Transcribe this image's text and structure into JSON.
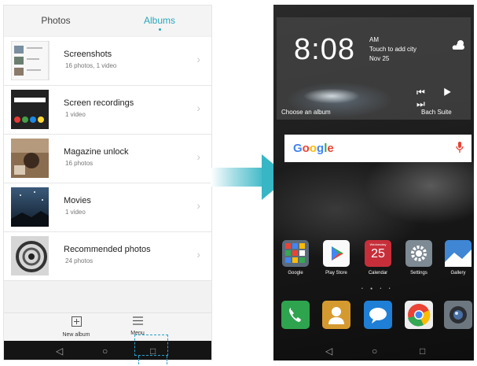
{
  "left_phone": {
    "tabs": [
      {
        "label": "Photos",
        "active": false
      },
      {
        "label": "Albums",
        "active": true
      }
    ],
    "accent_color": "#27a8ba",
    "albums": [
      {
        "title": "Screenshots",
        "subtitle": "16 photos, 1 video"
      },
      {
        "title": "Screen recordings",
        "subtitle": "1 video"
      },
      {
        "title": "Magazine unlock",
        "subtitle": "16 photos"
      },
      {
        "title": "Movies",
        "subtitle": "1 video"
      },
      {
        "title": "Recommended photos",
        "subtitle": "24 photos"
      }
    ],
    "chevron": "›",
    "bottom_bar": {
      "new_album_label": "New album",
      "new_album_icon": "add-square-icon",
      "menu_label": "Menu",
      "menu_icon": "menu-icon"
    },
    "nav": {
      "back": "◁",
      "home": "○",
      "recents": "□"
    }
  },
  "right_phone": {
    "clock": {
      "time": "8:08",
      "ampm": "AM",
      "city": "Touch to add city",
      "date": "Nov 25",
      "weather_icon": "partly-cloudy-icon"
    },
    "music": {
      "choose_album": "Choose an album",
      "artist": "Bach Suite",
      "controls": "⏮ ▶ ⏭"
    },
    "search": {
      "logo": "Google",
      "mic_icon": "microphone-icon"
    },
    "apps": [
      {
        "label": "Google",
        "icon": "google-folder-icon"
      },
      {
        "label": "Play Store",
        "icon": "play-store-icon"
      },
      {
        "label": "Calendar",
        "icon": "calendar-icon",
        "month": "Wednesday",
        "day": "25"
      },
      {
        "label": "Settings",
        "icon": "settings-gear-icon"
      },
      {
        "label": "Gallery",
        "icon": "gallery-icon"
      }
    ],
    "page_dots": "• ● • •",
    "dock": [
      {
        "icon": "phone-icon"
      },
      {
        "icon": "contacts-icon"
      },
      {
        "icon": "messages-icon"
      },
      {
        "icon": "chrome-icon"
      },
      {
        "icon": "camera-icon"
      }
    ],
    "nav": {
      "back": "◁",
      "home": "○",
      "recents": "□"
    }
  },
  "arrow_color": "#37b6c5",
  "highlight_color": "#2aa0c8"
}
